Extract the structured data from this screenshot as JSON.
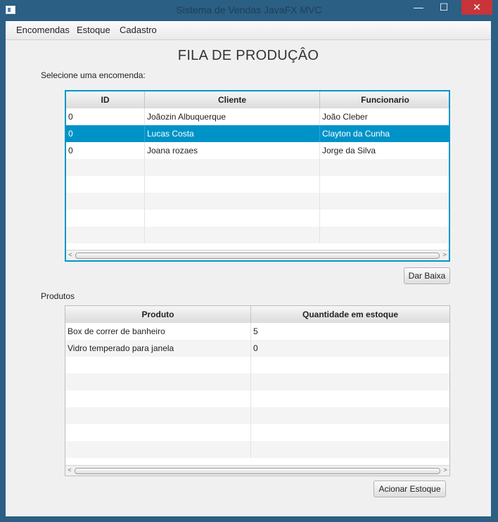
{
  "window": {
    "title": "Sistema de Vendas JavaFX MVC",
    "controls": {
      "minimize": "—",
      "maximize": "☐",
      "close": "✕"
    }
  },
  "menubar": {
    "items": [
      "Encomendas",
      "Estoque",
      "Cadastro"
    ]
  },
  "page_title": "FILA DE PRODUÇÂO",
  "orders": {
    "prompt": "Selecione uma encomenda:",
    "columns": [
      "ID",
      "Cliente",
      "Funcionario"
    ],
    "rows": [
      [
        "0",
        "Joãozin Albuquerque",
        "João Cleber"
      ],
      [
        "0",
        "Lucas Costa",
        "Clayton da Cunha"
      ],
      [
        "0",
        "Joana rozaes",
        "Jorge da Silva"
      ]
    ],
    "selected_row": 1,
    "button": "Dar Baixa"
  },
  "products": {
    "label": "Produtos",
    "columns": [
      "Produto",
      "Quantidade em estoque"
    ],
    "rows": [
      [
        "Box de correr de banheiro",
        "5"
      ],
      [
        "Vidro temperado para janela",
        "0"
      ]
    ],
    "button": "Acionar Estoque"
  },
  "scroll_arrows": {
    "left": "<",
    "right": ">"
  }
}
